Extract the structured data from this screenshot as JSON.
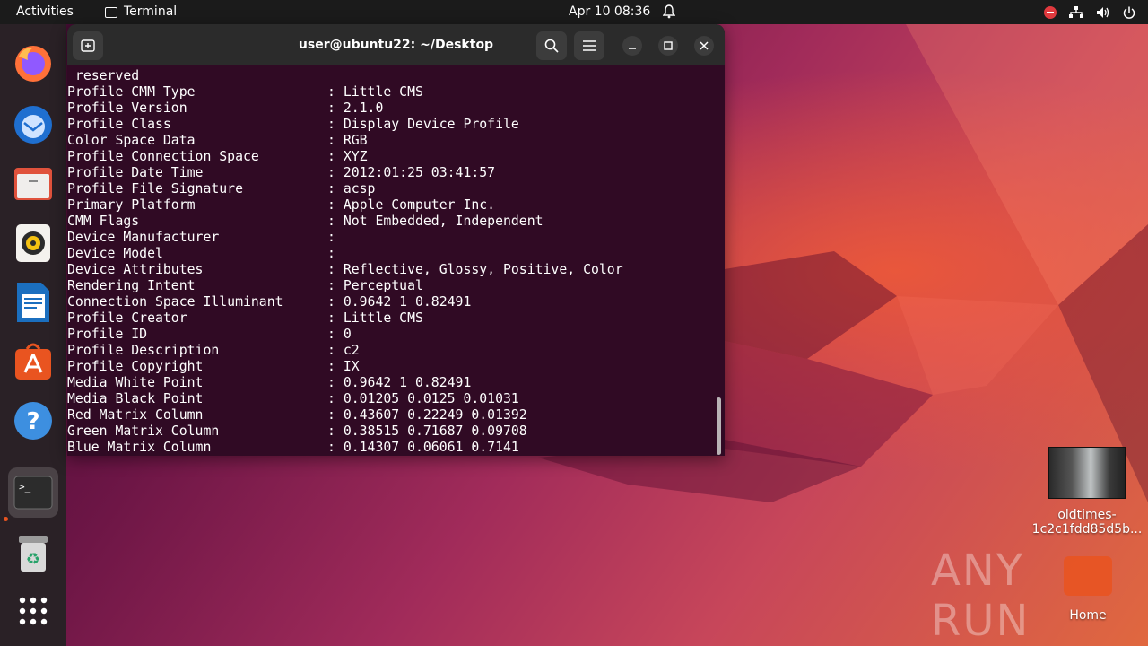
{
  "topbar": {
    "activities": "Activities",
    "app_name": "Terminal",
    "clock": "Apr 10  08:36"
  },
  "dock": {
    "items": [
      "firefox",
      "thunderbird",
      "files",
      "rhythmbox",
      "libreoffice-writer",
      "app-center",
      "help",
      "terminal",
      "trash",
      "show-apps"
    ]
  },
  "window": {
    "title": "user@ubuntu22: ~/Desktop"
  },
  "terminal": {
    "first_line": " reserved",
    "lines": [
      {
        "label": "Profile CMM Type",
        "value": ": Little CMS"
      },
      {
        "label": "Profile Version",
        "value": ": 2.1.0"
      },
      {
        "label": "Profile Class",
        "value": ": Display Device Profile"
      },
      {
        "label": "Color Space Data",
        "value": ": RGB"
      },
      {
        "label": "Profile Connection Space",
        "value": ": XYZ"
      },
      {
        "label": "Profile Date Time",
        "value": ": 2012:01:25 03:41:57"
      },
      {
        "label": "Profile File Signature",
        "value": ": acsp"
      },
      {
        "label": "Primary Platform",
        "value": ": Apple Computer Inc."
      },
      {
        "label": "CMM Flags",
        "value": ": Not Embedded, Independent"
      },
      {
        "label": "Device Manufacturer",
        "value": ":"
      },
      {
        "label": "Device Model",
        "value": ":"
      },
      {
        "label": "Device Attributes",
        "value": ": Reflective, Glossy, Positive, Color"
      },
      {
        "label": "Rendering Intent",
        "value": ": Perceptual"
      },
      {
        "label": "Connection Space Illuminant",
        "value": ": 0.9642 1 0.82491"
      },
      {
        "label": "Profile Creator",
        "value": ": Little CMS"
      },
      {
        "label": "Profile ID",
        "value": ": 0"
      },
      {
        "label": "Profile Description",
        "value": ": c2"
      },
      {
        "label": "Profile Copyright",
        "value": ": IX"
      },
      {
        "label": "Media White Point",
        "value": ": 0.9642 1 0.82491"
      },
      {
        "label": "Media Black Point",
        "value": ": 0.01205 0.0125 0.01031"
      },
      {
        "label": "Red Matrix Column",
        "value": ": 0.43607 0.22249 0.01392"
      },
      {
        "label": "Green Matrix Column",
        "value": ": 0.38515 0.71687 0.09708"
      },
      {
        "label": "Blue Matrix Column",
        "value": ": 0.14307 0.06061 0.7141"
      }
    ]
  },
  "desktop": {
    "file_label_1": "oldtimes-",
    "file_label_2": "1c2c1fdd85d5b...",
    "home_label": "Home",
    "watermark": "ANY RUN"
  },
  "colors": {
    "terminal_bg": "#300a24",
    "accent": "#e95420",
    "topbar_bg": "#1b1b1b"
  }
}
